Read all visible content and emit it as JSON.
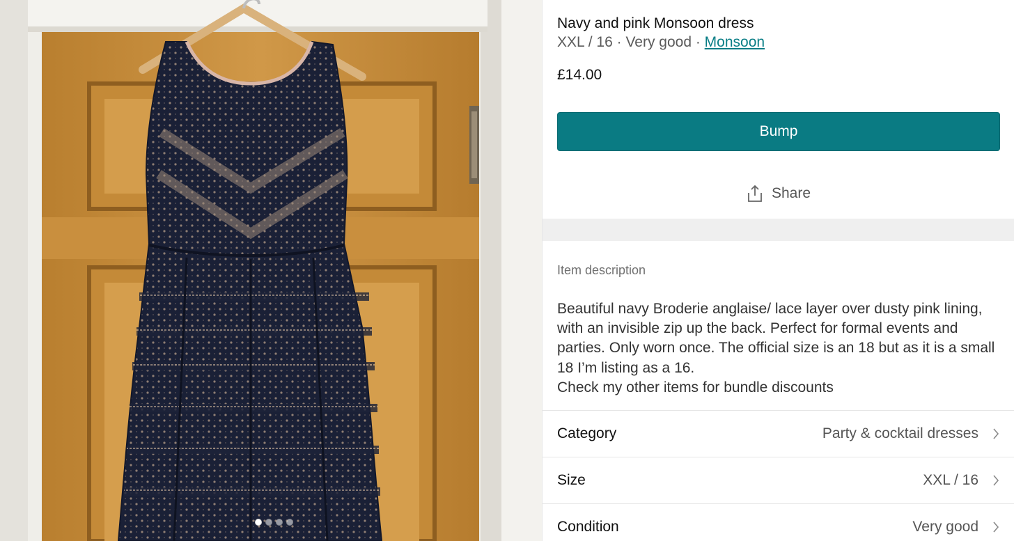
{
  "listing": {
    "title": "Navy and pink Monsoon dress",
    "size_condition": "XXL / 16 · Very good · ",
    "brand": "Monsoon",
    "price": "£14.00"
  },
  "actions": {
    "bump_label": "Bump",
    "share_label": "Share"
  },
  "description": {
    "label": "Item description",
    "lines": [
      "Beautiful navy Broderie anglaise/ lace layer over dusty pink lining,",
      "with an invisible zip up the back. Perfect for formal events and",
      "parties. Only worn once. The official size is an 18 but as it is a small",
      "18 I’m listing as a 16.",
      "Check my other items for bundle discounts"
    ]
  },
  "details": [
    {
      "key": "Category",
      "value": "Party & cocktail dresses"
    },
    {
      "key": "Size",
      "value": "XXL / 16"
    },
    {
      "key": "Condition",
      "value": "Very good"
    }
  ],
  "gallery": {
    "photo_count": 4,
    "active_index": 0
  },
  "colors": {
    "accent": "#0a7b83",
    "link": "#0a7e86",
    "door": "#c9913e",
    "dress": "#1b2138"
  },
  "icons": {
    "share": "share-upload-icon",
    "chevron": "chevron-right-icon"
  }
}
